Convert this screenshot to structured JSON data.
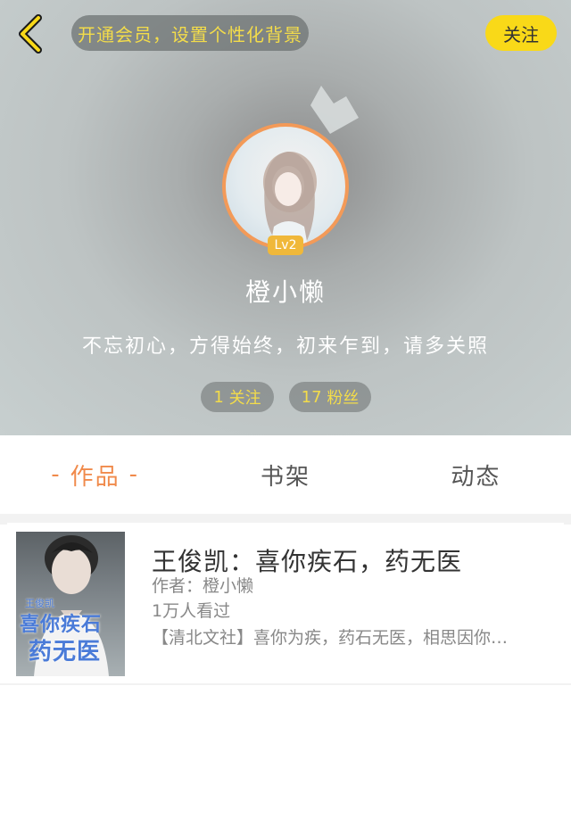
{
  "header": {
    "vip_banner": "开通会员，设置个性化背景",
    "follow_label": "关注"
  },
  "profile": {
    "level_badge": "Lv2",
    "username": "橙小懒",
    "bio": "不忘初心，方得始终，初来乍到，请多关照",
    "following_count": "1",
    "following_label": "关注",
    "fans_count": "17",
    "fans_label": "粉丝"
  },
  "tabs": [
    {
      "label": "作品",
      "active": true
    },
    {
      "label": "书架",
      "active": false
    },
    {
      "label": "动态",
      "active": false
    }
  ],
  "works": [
    {
      "title": "王俊凯：喜你疾石，药无医",
      "author": "作者：橙小懒",
      "views": "1万人看过",
      "description": "【清北文社】喜你为疾，药石无医，相思因你…",
      "cover_text_top": "王俊凯",
      "cover_text_1": "喜你疾石",
      "cover_text_2": "药无医"
    }
  ],
  "colors": {
    "accent_orange": "#f08a4b",
    "yellow": "#f9d918",
    "gold_text": "#f3dc4a",
    "avatar_ring": "#f39a58"
  },
  "icons": {
    "back": "chevron-left-icon",
    "crown": "crown-icon"
  }
}
